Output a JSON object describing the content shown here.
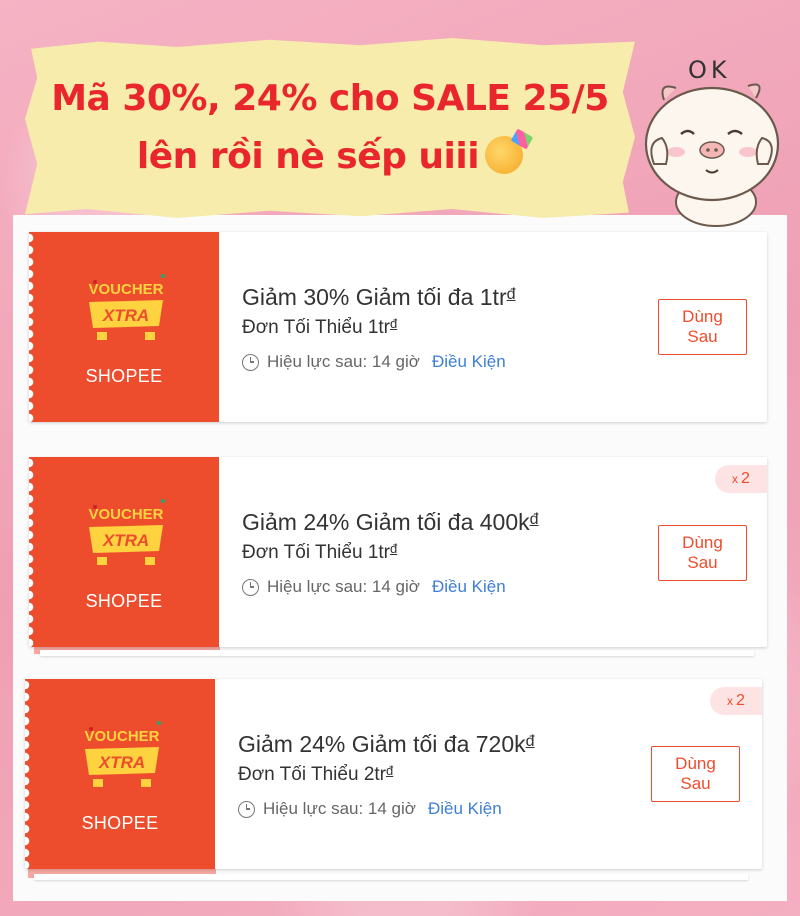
{
  "headline": {
    "line1": "Mã 30%, 24% cho SALE 25/5",
    "line2": "lên rồi nè sếp uiii",
    "emoji": "party-face-emoji"
  },
  "mascot": {
    "text": "OK"
  },
  "vouchers": [
    {
      "badge_top": "VOUCHER",
      "badge_bottom": "XTRA",
      "brand": "SHOPEE",
      "title": "Giảm 30% Giảm tối đa 1tr",
      "title_currency": "đ",
      "min_order": "Đơn Tối Thiểu 1tr",
      "min_currency": "đ",
      "validity": "Hiệu lực sau: 14 giờ",
      "conditions": "Điều Kiện",
      "button": "Dùng Sau",
      "quantity": null
    },
    {
      "badge_top": "VOUCHER",
      "badge_bottom": "XTRA",
      "brand": "SHOPEE",
      "title": "Giảm 24% Giảm tối đa 400k",
      "title_currency": "đ",
      "min_order": "Đơn Tối Thiểu 1tr",
      "min_currency": "đ",
      "validity": "Hiệu lực sau: 14 giờ",
      "conditions": "Điều Kiện",
      "button": "Dùng Sau",
      "quantity_x": "x",
      "quantity": "2"
    },
    {
      "badge_top": "VOUCHER",
      "badge_bottom": "XTRA",
      "brand": "SHOPEE",
      "title": "Giảm 24% Giảm tối đa 720k",
      "title_currency": "đ",
      "min_order": "Đơn Tối Thiểu 2tr",
      "min_currency": "đ",
      "validity": "Hiệu lực sau: 14 giờ",
      "conditions": "Điều Kiện",
      "button": "Dùng Sau",
      "quantity_x": "x",
      "quantity": "2"
    }
  ],
  "colors": {
    "accent": "#ee4d2d",
    "headline": "#e8262c",
    "link": "#3d7fd6",
    "banner": "#f7ecab",
    "background": "#f3a9bd"
  }
}
